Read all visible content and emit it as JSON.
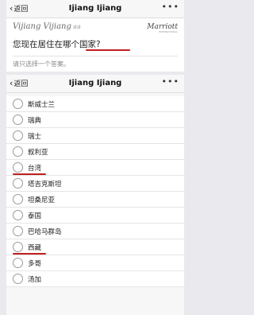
{
  "screen1": {
    "nav": {
      "back": "返回",
      "title": "Ijiang Ijiang",
      "more": "•••"
    },
    "brand": {
      "script": "Vijiang Vijiang",
      "tag": "讲讲",
      "logo": "Marriott",
      "logo_sub": "INTERNATIONAL"
    },
    "question": "您现在居住在哪个国家?",
    "hint": "请只选择一个答案。"
  },
  "screen2": {
    "nav": {
      "back": "返回",
      "title": "Ijiang Ijiang",
      "more": "•••"
    },
    "options": [
      "斯威士兰",
      "瑞典",
      "瑞士",
      "叙利亚",
      "台湾",
      "塔吉克斯坦",
      "坦桑尼亚",
      "泰国",
      "巴哈马群岛",
      "西藏",
      "多哥",
      "汤加"
    ]
  },
  "colors": {
    "annotation": "#c02020"
  }
}
